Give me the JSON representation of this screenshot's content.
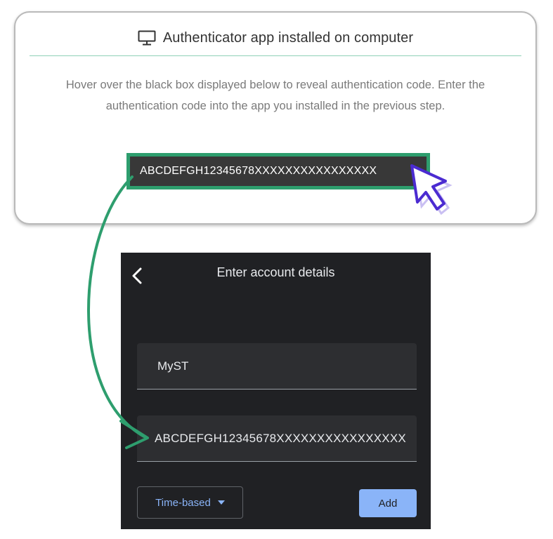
{
  "card": {
    "title": "Authenticator app installed on computer",
    "description": "Hover over the black box displayed below to reveal authentication code. Enter the authentication code into the app you installed in the previous step.",
    "code": "ABCDEFGH12345678XXXXXXXXXXXXXXXX",
    "icon": "monitor-icon"
  },
  "phone": {
    "title": "Enter account details",
    "account_name_value": "MyST",
    "key_value": "ABCDEFGH12345678XXXXXXXXXXXXXXXX",
    "type_select": "Time-based",
    "add_label": "Add"
  },
  "colors": {
    "accent_green": "#2e9e6e",
    "cursor_purple": "#4b2bd1",
    "phone_bg": "#202124",
    "link_blue": "#8ab4f8"
  }
}
